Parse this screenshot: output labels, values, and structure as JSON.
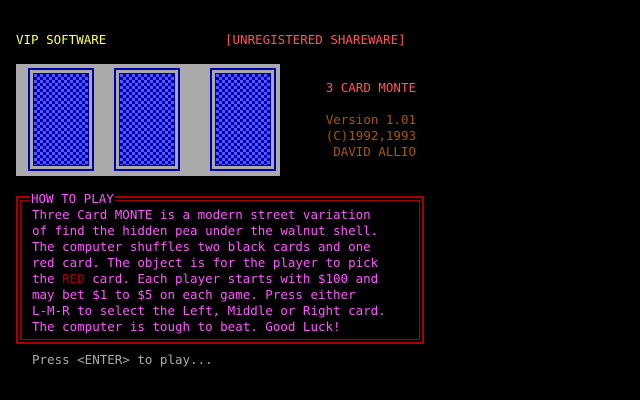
{
  "header": {
    "vendor": "VIP SOFTWARE",
    "registration": "[UNREGISTERED SHAREWARE]"
  },
  "cards": [
    {
      "name": "left-card",
      "face": "down"
    },
    {
      "name": "middle-card",
      "face": "down"
    },
    {
      "name": "right-card",
      "face": "down"
    }
  ],
  "title_block": {
    "game_title": "3 CARD MONTE",
    "version": "Version 1.01",
    "copyright": "(C)1992,1993",
    "author": "DAVID ALLIO"
  },
  "how_to_play": {
    "heading": "HOW TO PLAY",
    "lines": [
      "Three Card MONTE is a modern street variation",
      "of find the hidden pea under the walnut shell.",
      "The computer shuffles two black cards and one",
      "red card. The object is for the player to pick"
    ],
    "line5_pre": "the ",
    "line5_highlight": "RED",
    "line5_post": " card. Each player starts with $100 and",
    "lines_after": [
      "may bet $1 to $5 on each game. Press either",
      "L-M-R to select the Left, Middle or Right card.",
      "The computer is tough to beat. Good Luck!"
    ]
  },
  "prompt": "Press <ENTER> to play...",
  "colors": {
    "background": "#000000",
    "yellow": "#ffff55",
    "light_red": "#ff5555",
    "brown": "#aa5500",
    "magenta": "#ff55ff",
    "dark_red": "#aa0000",
    "gray": "#aaaaaa",
    "card_blue": "#0000aa",
    "card_light_blue": "#5555ff"
  }
}
